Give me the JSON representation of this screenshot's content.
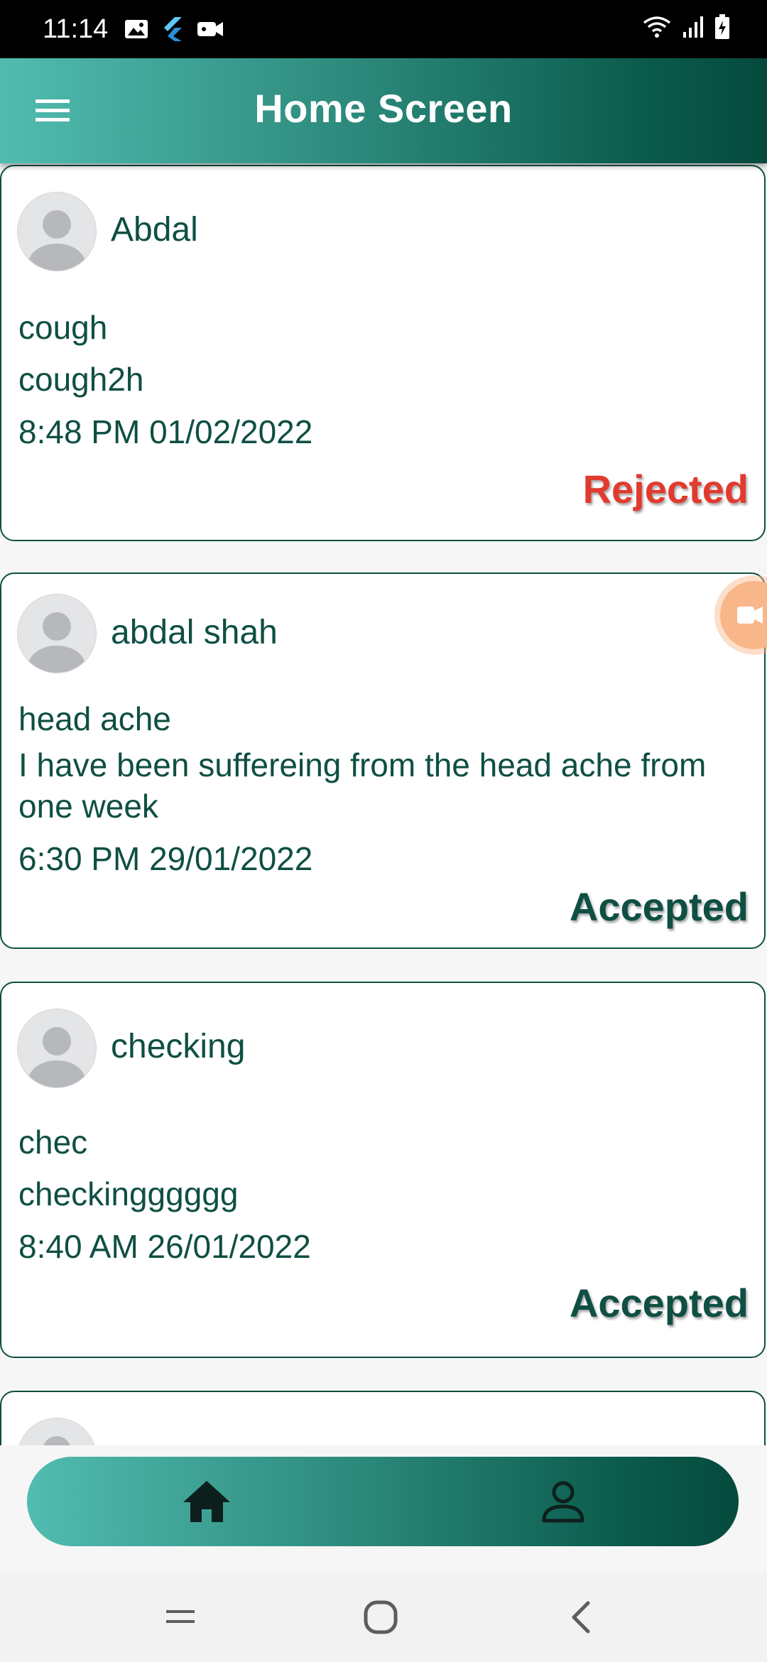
{
  "status_bar": {
    "time": "11:14"
  },
  "app_bar": {
    "title": "Home Screen"
  },
  "requests": [
    {
      "name": "Abdal",
      "subject": "cough",
      "description": "cough2h",
      "datetime": "8:48 PM 01/02/2022",
      "status": "Rejected"
    },
    {
      "name": "abdal shah",
      "subject": "head ache",
      "description": "I have been suffereing from the head ache from one week",
      "datetime": "6:30 PM 29/01/2022",
      "status": "Accepted"
    },
    {
      "name": "checking",
      "subject": "chec",
      "description": "checkingggggg",
      "datetime": "8:40 AM 26/01/2022",
      "status": "Accepted"
    },
    {
      "name": "",
      "subject": "",
      "description": "",
      "datetime": "",
      "status": ""
    }
  ],
  "bottom_nav": {
    "items": [
      "home-icon",
      "profile-icon"
    ]
  },
  "colors": {
    "primary_dark": "#0f4f43",
    "gradient_start": "#51bcb0",
    "rejected": "#e23a2e"
  }
}
